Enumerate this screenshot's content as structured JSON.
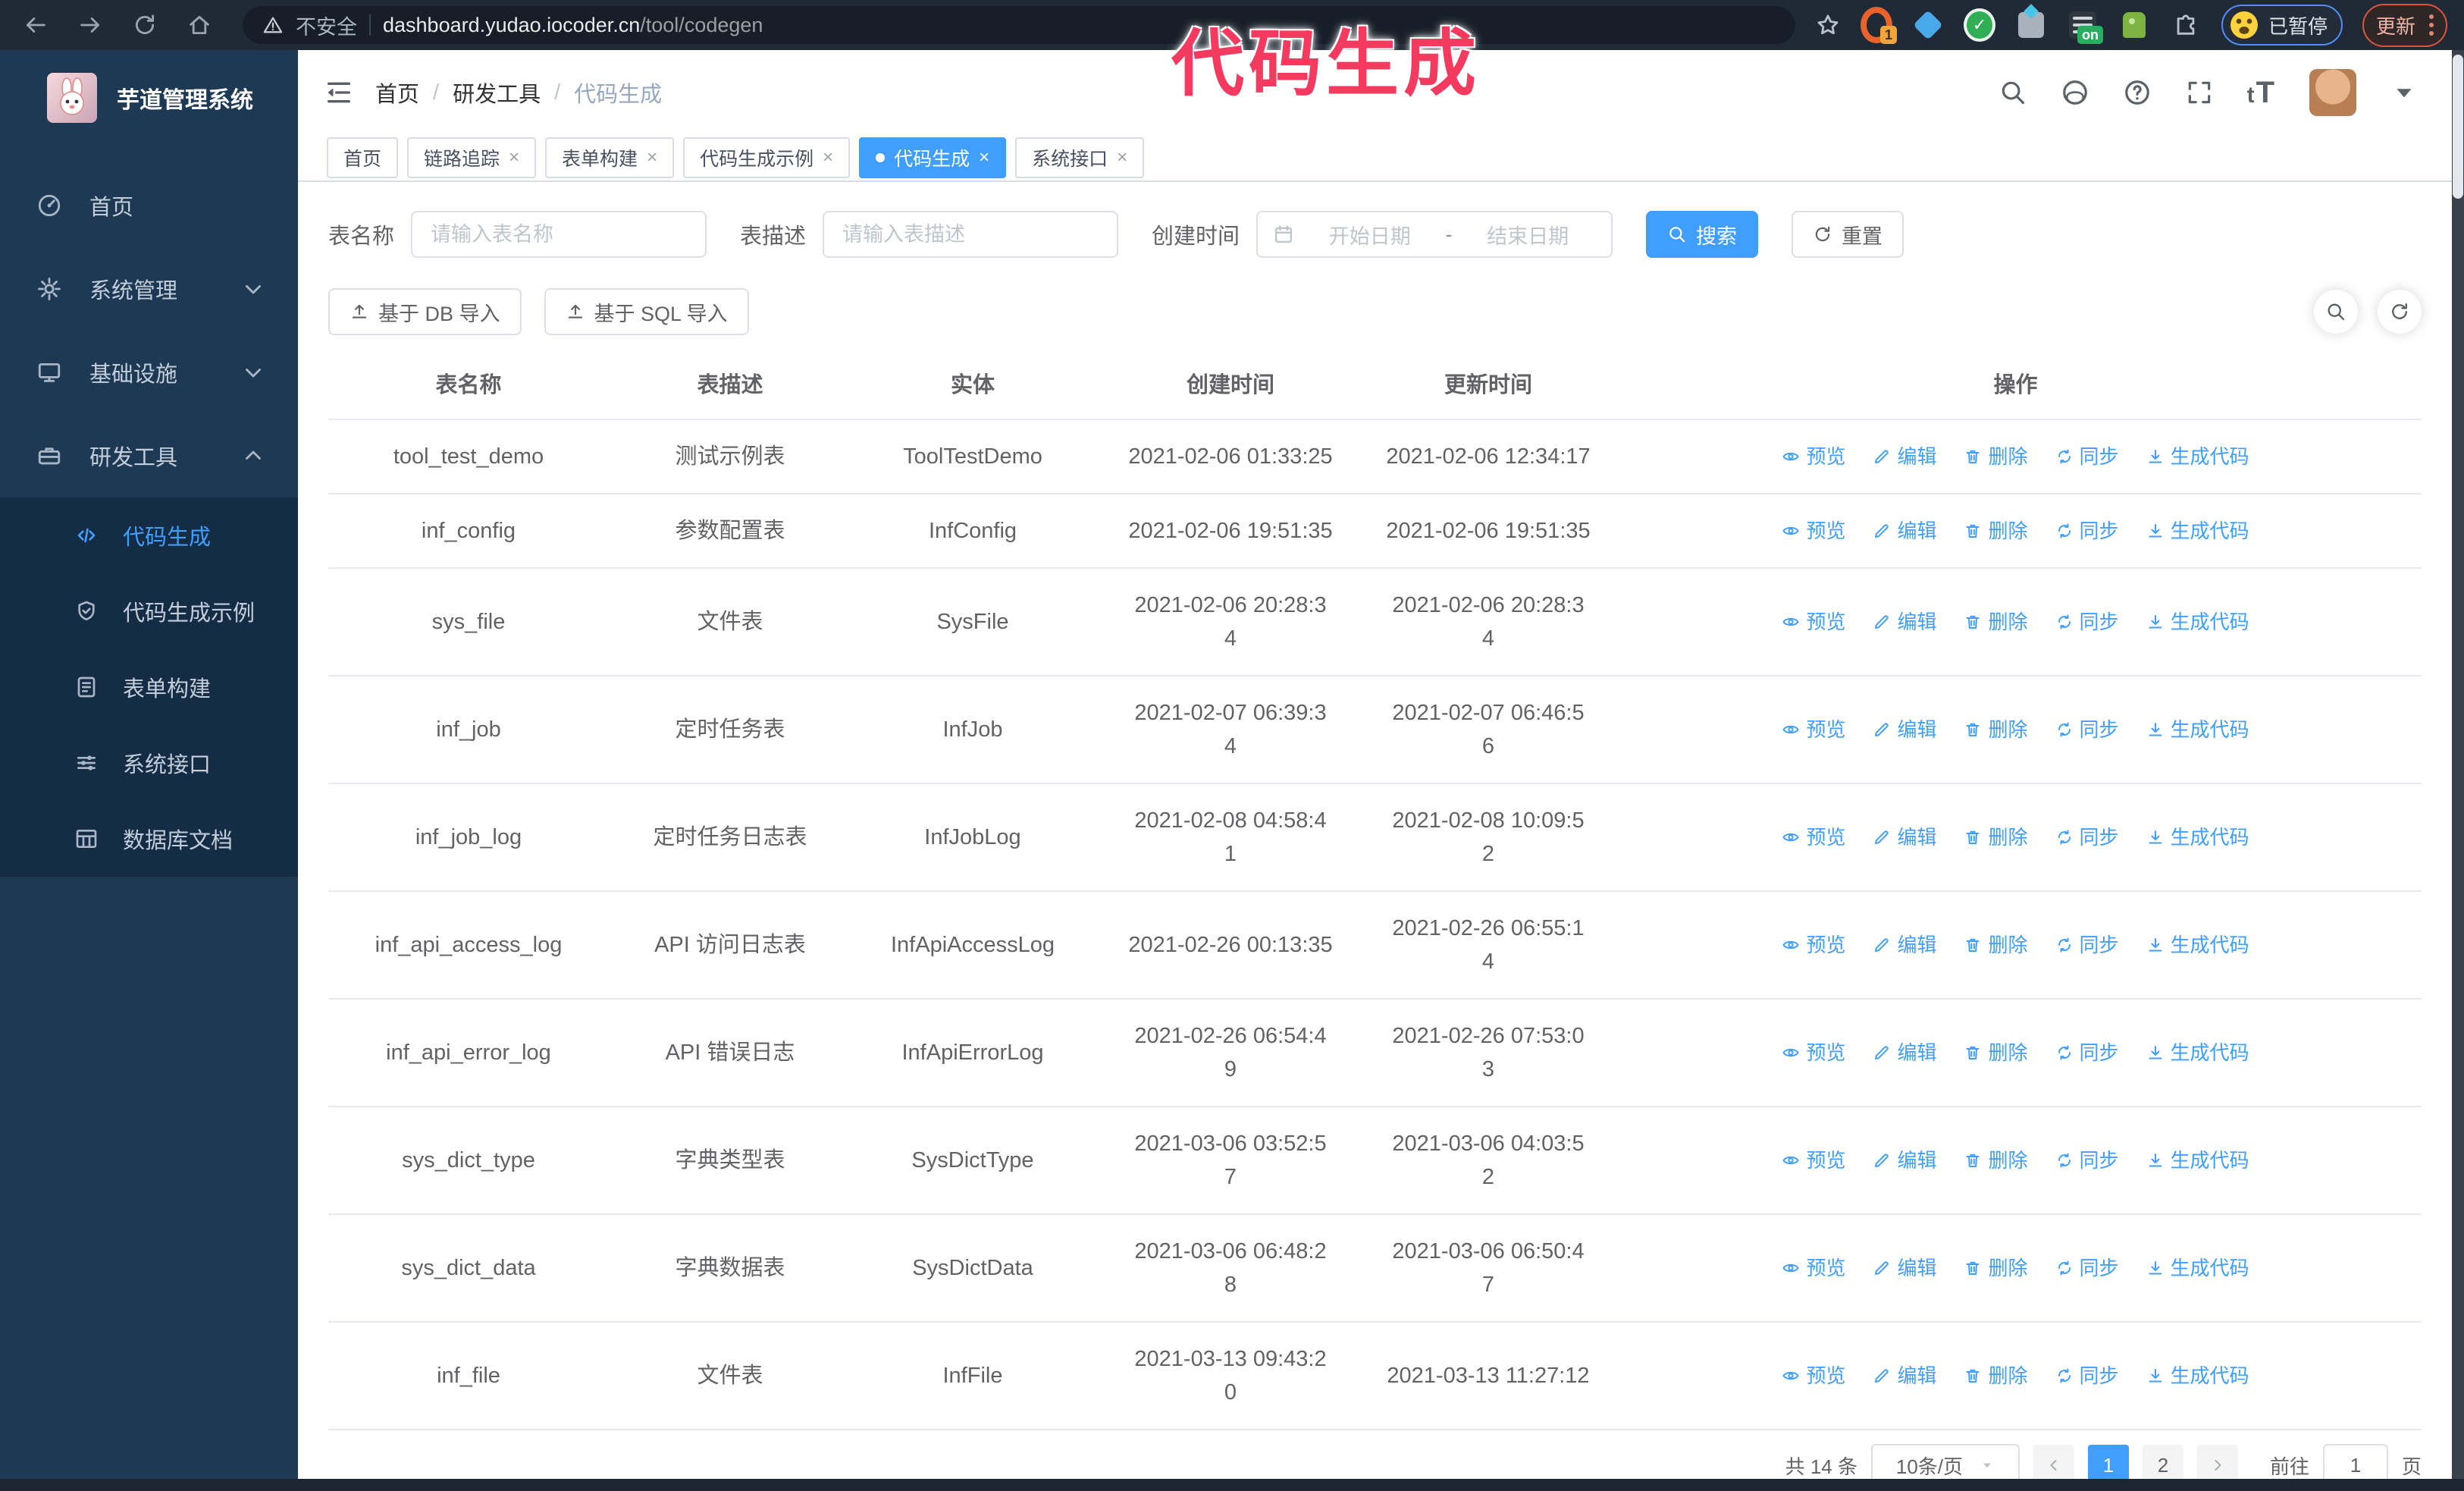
{
  "ui": {
    "close_glyph": "×",
    "breadcrumb_separator": "/"
  },
  "colors": {
    "accent": "#409EFF",
    "sidebar_bg": "#1d3953",
    "submenu_bg": "#142c44",
    "annotation": "#f43b5f"
  },
  "annotation": {
    "text": "代码生成"
  },
  "browser": {
    "security_label": "不安全",
    "url_host": "dashboard.yudao.iocoder.cn",
    "url_path": "/tool/codegen",
    "ext_badge_count": "1",
    "ext_badge_on": "on",
    "paused_badge": "已暂停",
    "update_button": "更新"
  },
  "sidebar": {
    "title": "芋道管理系统",
    "items": [
      {
        "label": "首页",
        "icon": "dashboard",
        "chevron": ""
      },
      {
        "label": "系统管理",
        "icon": "gear",
        "chevron": "down"
      },
      {
        "label": "基础设施",
        "icon": "monitor",
        "chevron": "down"
      },
      {
        "label": "研发工具",
        "icon": "toolbox",
        "chevron": "up"
      }
    ],
    "sub_items": [
      {
        "label": "代码生成",
        "icon": "code",
        "active": true
      },
      {
        "label": "代码生成示例",
        "icon": "shield-check",
        "active": false
      },
      {
        "label": "表单构建",
        "icon": "form",
        "active": false
      },
      {
        "label": "系统接口",
        "icon": "sliders",
        "active": false
      },
      {
        "label": "数据库文档",
        "icon": "db-table",
        "active": false
      }
    ]
  },
  "breadcrumb": [
    "首页",
    "研发工具",
    "代码生成"
  ],
  "tabs": [
    {
      "label": "首页",
      "closable": false,
      "active": false
    },
    {
      "label": "链路追踪",
      "closable": true,
      "active": false
    },
    {
      "label": "表单构建",
      "closable": true,
      "active": false
    },
    {
      "label": "代码生成示例",
      "closable": true,
      "active": false
    },
    {
      "label": "代码生成",
      "closable": true,
      "active": true
    },
    {
      "label": "系统接口",
      "closable": true,
      "active": false
    }
  ],
  "filters": {
    "table_name_label": "表名称",
    "table_name_placeholder": "请输入表名称",
    "table_desc_label": "表描述",
    "table_desc_placeholder": "请输入表描述",
    "create_time_label": "创建时间",
    "date_start_placeholder": "开始日期",
    "date_separator": "-",
    "date_end_placeholder": "结束日期",
    "search_button": "搜索",
    "reset_button": "重置"
  },
  "toolbar": {
    "import_db_button": "基于 DB 导入",
    "import_sql_button": "基于 SQL 导入"
  },
  "table": {
    "columns": [
      "表名称",
      "表描述",
      "实体",
      "创建时间",
      "更新时间",
      "操作"
    ],
    "actions": [
      {
        "label": "预览",
        "icon": "eye"
      },
      {
        "label": "编辑",
        "icon": "pencil"
      },
      {
        "label": "删除",
        "icon": "trash"
      },
      {
        "label": "同步",
        "icon": "sync"
      },
      {
        "label": "生成代码",
        "icon": "download"
      }
    ],
    "rows": [
      {
        "name": "tool_test_demo",
        "desc": "测试示例表",
        "entity": "ToolTestDemo",
        "created": "2021-02-06 01:33:25",
        "updated": "2021-02-06 12:34:17"
      },
      {
        "name": "inf_config",
        "desc": "参数配置表",
        "entity": "InfConfig",
        "created": "2021-02-06 19:51:35",
        "updated": "2021-02-06 19:51:35"
      },
      {
        "name": "sys_file",
        "desc": "文件表",
        "entity": "SysFile",
        "created": "2021-02-06 20:28:3\n4",
        "updated": "2021-02-06 20:28:3\n4"
      },
      {
        "name": "inf_job",
        "desc": "定时任务表",
        "entity": "InfJob",
        "created": "2021-02-07 06:39:3\n4",
        "updated": "2021-02-07 06:46:5\n6"
      },
      {
        "name": "inf_job_log",
        "desc": "定时任务日志表",
        "entity": "InfJobLog",
        "created": "2021-02-08 04:58:4\n1",
        "updated": "2021-02-08 10:09:5\n2"
      },
      {
        "name": "inf_api_access_log",
        "desc": "API 访问日志表",
        "entity": "InfApiAccessLog",
        "created": "2021-02-26 00:13:35",
        "updated": "2021-02-26 06:55:1\n4"
      },
      {
        "name": "inf_api_error_log",
        "desc": "API 错误日志",
        "entity": "InfApiErrorLog",
        "created": "2021-02-26 06:54:4\n9",
        "updated": "2021-02-26 07:53:0\n3"
      },
      {
        "name": "sys_dict_type",
        "desc": "字典类型表",
        "entity": "SysDictType",
        "created": "2021-03-06 03:52:5\n7",
        "updated": "2021-03-06 04:03:5\n2"
      },
      {
        "name": "sys_dict_data",
        "desc": "字典数据表",
        "entity": "SysDictData",
        "created": "2021-03-06 06:48:2\n8",
        "updated": "2021-03-06 06:50:4\n7"
      },
      {
        "name": "inf_file",
        "desc": "文件表",
        "entity": "InfFile",
        "created": "2021-03-13 09:43:2\n0",
        "updated": "2021-03-13 11:27:12"
      }
    ]
  },
  "pagination": {
    "total": "共 14 条",
    "page_size": "10条/页",
    "pages": [
      "1",
      "2"
    ],
    "active_page": "1",
    "goto_label": "前往",
    "goto_value": "1",
    "goto_suffix": "页"
  }
}
